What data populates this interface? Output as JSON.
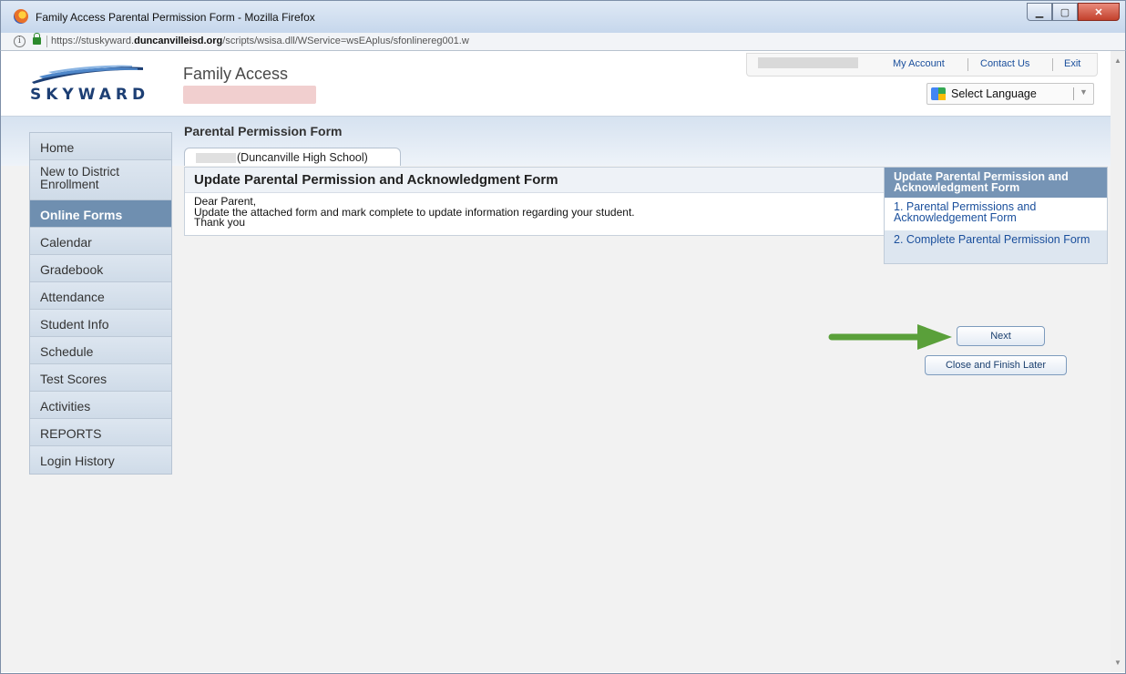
{
  "window": {
    "title": "Family Access Parental Permission Form - Mozilla Firefox",
    "minimize": "▁",
    "maximize": "▢",
    "close": "✕"
  },
  "browser": {
    "url_prefix": "https://stuskyward.",
    "url_domain": "duncanvilleisd.org",
    "url_path": "/scripts/wsisa.dll/WService=wsEAplus/sfonlinereg001.w"
  },
  "header": {
    "logo_text": "SKYWARD",
    "app_title": "Family Access",
    "links": [
      "My Account",
      "Contact Us",
      "Exit"
    ],
    "language_label": "Select Language",
    "language_arrow": "▼"
  },
  "sidebar": {
    "items": [
      {
        "label": "Home"
      },
      {
        "label": "New to District\nEnrollment"
      },
      {
        "label": "Online Forms"
      },
      {
        "label": "Calendar"
      },
      {
        "label": "Gradebook"
      },
      {
        "label": "Attendance"
      },
      {
        "label": "Student Info"
      },
      {
        "label": "Schedule"
      },
      {
        "label": "Test Scores"
      },
      {
        "label": "Activities"
      },
      {
        "label": "REPORTS"
      },
      {
        "label": "Login History"
      }
    ]
  },
  "main": {
    "page_title": "Parental Permission Form",
    "tab_label": "(Duncanville High School)",
    "panel_title": "Update Parental Permission and Acknowledgment Form",
    "body_lines": [
      "Dear Parent,",
      "Update the attached form and mark complete to update information regarding your student.",
      "Thank you"
    ]
  },
  "steps": {
    "header": "Update Parental Permission and Acknowledgment Form",
    "items": [
      "1. Parental Permissions and Acknowledgement Form",
      "2. Complete Parental Permission Form"
    ]
  },
  "buttons": {
    "next": "Next",
    "close_later": "Close and Finish Later"
  },
  "colors": {
    "accent": "#7694b5",
    "active_nav": "#6f8fb0",
    "link": "#1a4f9c",
    "arrow": "#5aa03a"
  }
}
